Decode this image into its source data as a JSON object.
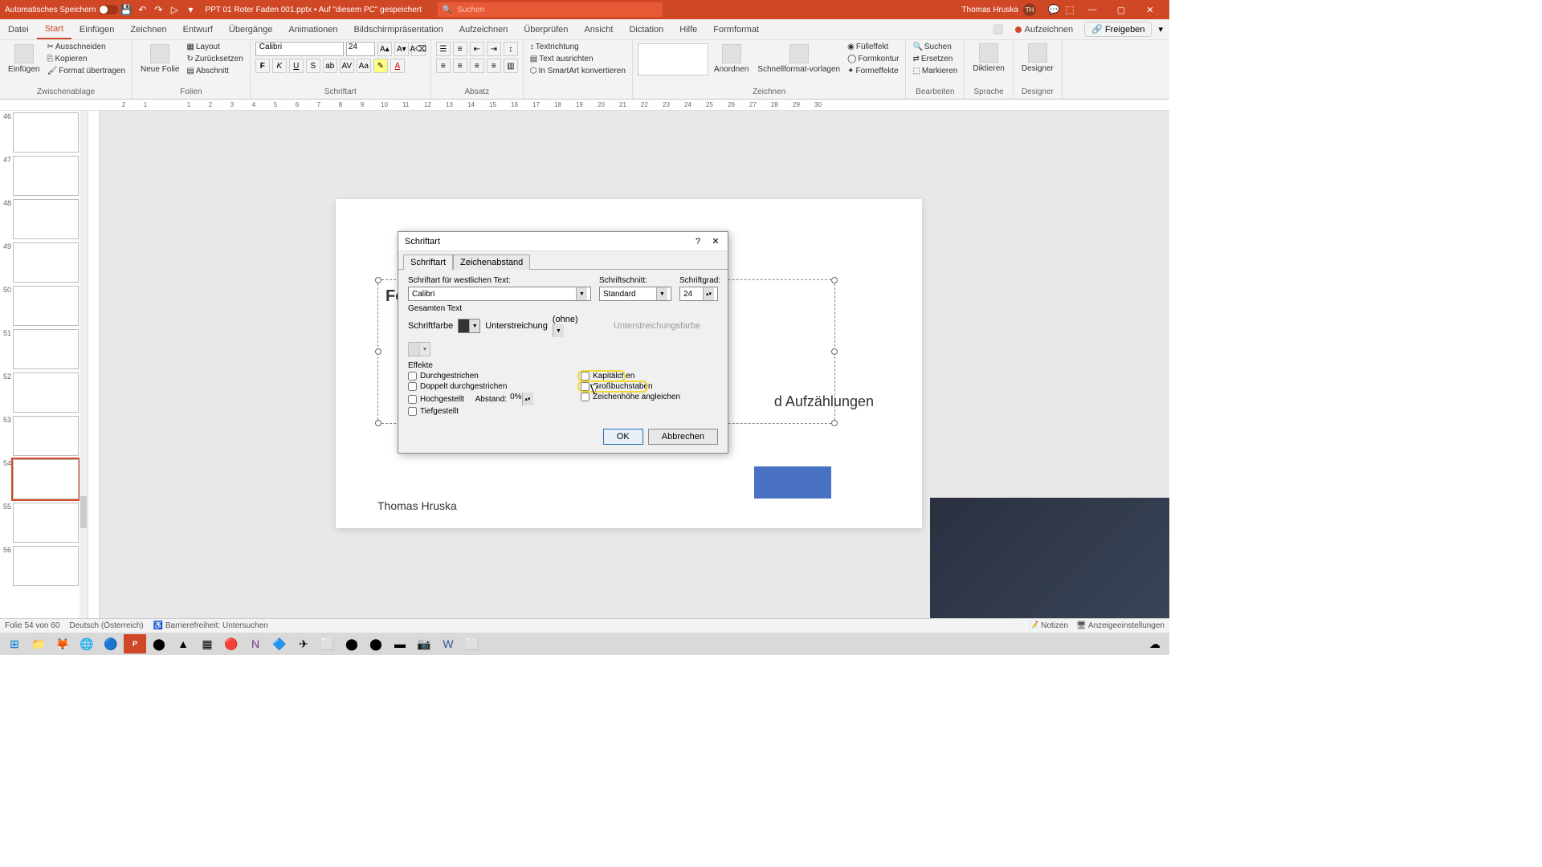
{
  "titlebar": {
    "autosave": "Automatisches Speichern",
    "filename": "PPT 01 Roter Faden 001.pptx • Auf \"diesem PC\" gespeichert",
    "search_placeholder": "Suchen",
    "user_name": "Thomas Hruska",
    "user_initials": "TH"
  },
  "menu": {
    "tabs": [
      "Datei",
      "Start",
      "Einfügen",
      "Zeichnen",
      "Entwurf",
      "Übergänge",
      "Animationen",
      "Bildschirmpräsentation",
      "Aufzeichnen",
      "Überprüfen",
      "Ansicht",
      "Dictation",
      "Hilfe",
      "Formformat"
    ],
    "record": "Aufzeichnen",
    "share": "Freigeben"
  },
  "ribbon": {
    "paste": "Einfügen",
    "cut": "Ausschneiden",
    "copy": "Kopieren",
    "format_painter": "Format übertragen",
    "clipboard": "Zwischenablage",
    "new_slide": "Neue Folie",
    "layout": "Layout",
    "reset": "Zurücksetzen",
    "section": "Abschnitt",
    "slides": "Folien",
    "font_name": "Calibri",
    "font_size": "24",
    "font": "Schriftart",
    "paragraph": "Absatz",
    "text_dir": "Textrichtung",
    "align_text": "Text ausrichten",
    "smartart": "In SmartArt konvertieren",
    "arrange": "Anordnen",
    "quickstyles": "Schnellformat-vorlagen",
    "fill": "Fülleffekt",
    "outline": "Formkontur",
    "effects": "Formeffekte",
    "drawing": "Zeichnen",
    "find": "Suchen",
    "replace": "Ersetzen",
    "select": "Markieren",
    "editing": "Bearbeiten",
    "dictate": "Diktieren",
    "language": "Sprache",
    "designer": "Designer"
  },
  "ruler": [
    "2",
    "1",
    "",
    "1",
    "2",
    "3",
    "4",
    "5",
    "6",
    "7",
    "8",
    "9",
    "10",
    "11",
    "12",
    "13",
    "14",
    "15",
    "16",
    "17",
    "18",
    "19",
    "20",
    "21",
    "22",
    "23",
    "24",
    "25",
    "26",
    "27",
    "28",
    "29",
    "30"
  ],
  "thumbs": [
    {
      "n": "46"
    },
    {
      "n": "47"
    },
    {
      "n": "48"
    },
    {
      "n": "49"
    },
    {
      "n": "50"
    },
    {
      "n": "51"
    },
    {
      "n": "52"
    },
    {
      "n": "53"
    },
    {
      "n": "54",
      "sel": true
    },
    {
      "n": "55"
    },
    {
      "n": "56"
    }
  ],
  "slide": {
    "title_partial": "Fo",
    "subtitle_partial": "d Aufzählungen",
    "author": "Thomas Hruska"
  },
  "dialog": {
    "title": "Schriftart",
    "tab_font": "Schriftart",
    "tab_spacing": "Zeichenabstand",
    "latin_font_label": "Schriftart für westlichen Text:",
    "latin_font": "Calibri",
    "style_label": "Schriftschnitt:",
    "style": "Standard",
    "size_label": "Schriftgrad:",
    "size": "24",
    "all_text": "Gesamten Text",
    "font_color": "Schriftfarbe",
    "underline_label": "Unterstreichung",
    "underline": "(ohne)",
    "underline_color": "Unterstreichungsfarbe",
    "effects": "Effekte",
    "strike": "Durchgestrichen",
    "dblstrike": "Doppelt durchgestrichen",
    "superscript": "Hochgestellt",
    "subscript": "Tiefgestellt",
    "offset_label": "Abstand:",
    "offset": "0%",
    "smallcaps": "Kapitälchen",
    "allcaps": "Großbuchstaben",
    "equalize": "Zeichenhöhe angleichen",
    "ok": "OK",
    "cancel": "Abbrechen"
  },
  "status": {
    "slide_of": "Folie 54 von 60",
    "lang": "Deutsch (Österreich)",
    "a11y": "Barrierefreiheit: Untersuchen",
    "notes": "Notizen",
    "display": "Anzeigeeinstellungen"
  }
}
